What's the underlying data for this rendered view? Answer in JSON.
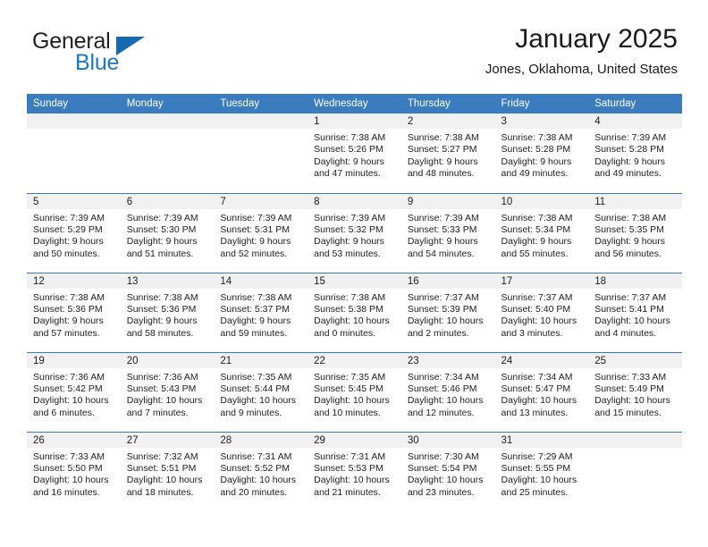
{
  "brand": {
    "name_part1": "General",
    "name_part2": "Blue",
    "accent_color": "#1b77c4"
  },
  "header": {
    "month_title": "January 2025",
    "location": "Jones, Oklahoma, United States"
  },
  "theme": {
    "header_bg": "#3a7cbe",
    "daynum_bg": "#f1f1f1",
    "text": "#222222"
  },
  "weekday_headers": [
    "Sunday",
    "Monday",
    "Tuesday",
    "Wednesday",
    "Thursday",
    "Friday",
    "Saturday"
  ],
  "weeks": [
    [
      {
        "day": "",
        "lines": []
      },
      {
        "day": "",
        "lines": []
      },
      {
        "day": "",
        "lines": []
      },
      {
        "day": "1",
        "lines": [
          "Sunrise: 7:38 AM",
          "Sunset: 5:26 PM",
          "Daylight: 9 hours",
          "and 47 minutes."
        ]
      },
      {
        "day": "2",
        "lines": [
          "Sunrise: 7:38 AM",
          "Sunset: 5:27 PM",
          "Daylight: 9 hours",
          "and 48 minutes."
        ]
      },
      {
        "day": "3",
        "lines": [
          "Sunrise: 7:38 AM",
          "Sunset: 5:28 PM",
          "Daylight: 9 hours",
          "and 49 minutes."
        ]
      },
      {
        "day": "4",
        "lines": [
          "Sunrise: 7:39 AM",
          "Sunset: 5:28 PM",
          "Daylight: 9 hours",
          "and 49 minutes."
        ]
      }
    ],
    [
      {
        "day": "5",
        "lines": [
          "Sunrise: 7:39 AM",
          "Sunset: 5:29 PM",
          "Daylight: 9 hours",
          "and 50 minutes."
        ]
      },
      {
        "day": "6",
        "lines": [
          "Sunrise: 7:39 AM",
          "Sunset: 5:30 PM",
          "Daylight: 9 hours",
          "and 51 minutes."
        ]
      },
      {
        "day": "7",
        "lines": [
          "Sunrise: 7:39 AM",
          "Sunset: 5:31 PM",
          "Daylight: 9 hours",
          "and 52 minutes."
        ]
      },
      {
        "day": "8",
        "lines": [
          "Sunrise: 7:39 AM",
          "Sunset: 5:32 PM",
          "Daylight: 9 hours",
          "and 53 minutes."
        ]
      },
      {
        "day": "9",
        "lines": [
          "Sunrise: 7:39 AM",
          "Sunset: 5:33 PM",
          "Daylight: 9 hours",
          "and 54 minutes."
        ]
      },
      {
        "day": "10",
        "lines": [
          "Sunrise: 7:38 AM",
          "Sunset: 5:34 PM",
          "Daylight: 9 hours",
          "and 55 minutes."
        ]
      },
      {
        "day": "11",
        "lines": [
          "Sunrise: 7:38 AM",
          "Sunset: 5:35 PM",
          "Daylight: 9 hours",
          "and 56 minutes."
        ]
      }
    ],
    [
      {
        "day": "12",
        "lines": [
          "Sunrise: 7:38 AM",
          "Sunset: 5:36 PM",
          "Daylight: 9 hours",
          "and 57 minutes."
        ]
      },
      {
        "day": "13",
        "lines": [
          "Sunrise: 7:38 AM",
          "Sunset: 5:36 PM",
          "Daylight: 9 hours",
          "and 58 minutes."
        ]
      },
      {
        "day": "14",
        "lines": [
          "Sunrise: 7:38 AM",
          "Sunset: 5:37 PM",
          "Daylight: 9 hours",
          "and 59 minutes."
        ]
      },
      {
        "day": "15",
        "lines": [
          "Sunrise: 7:38 AM",
          "Sunset: 5:38 PM",
          "Daylight: 10 hours",
          "and 0 minutes."
        ]
      },
      {
        "day": "16",
        "lines": [
          "Sunrise: 7:37 AM",
          "Sunset: 5:39 PM",
          "Daylight: 10 hours",
          "and 2 minutes."
        ]
      },
      {
        "day": "17",
        "lines": [
          "Sunrise: 7:37 AM",
          "Sunset: 5:40 PM",
          "Daylight: 10 hours",
          "and 3 minutes."
        ]
      },
      {
        "day": "18",
        "lines": [
          "Sunrise: 7:37 AM",
          "Sunset: 5:41 PM",
          "Daylight: 10 hours",
          "and 4 minutes."
        ]
      }
    ],
    [
      {
        "day": "19",
        "lines": [
          "Sunrise: 7:36 AM",
          "Sunset: 5:42 PM",
          "Daylight: 10 hours",
          "and 6 minutes."
        ]
      },
      {
        "day": "20",
        "lines": [
          "Sunrise: 7:36 AM",
          "Sunset: 5:43 PM",
          "Daylight: 10 hours",
          "and 7 minutes."
        ]
      },
      {
        "day": "21",
        "lines": [
          "Sunrise: 7:35 AM",
          "Sunset: 5:44 PM",
          "Daylight: 10 hours",
          "and 9 minutes."
        ]
      },
      {
        "day": "22",
        "lines": [
          "Sunrise: 7:35 AM",
          "Sunset: 5:45 PM",
          "Daylight: 10 hours",
          "and 10 minutes."
        ]
      },
      {
        "day": "23",
        "lines": [
          "Sunrise: 7:34 AM",
          "Sunset: 5:46 PM",
          "Daylight: 10 hours",
          "and 12 minutes."
        ]
      },
      {
        "day": "24",
        "lines": [
          "Sunrise: 7:34 AM",
          "Sunset: 5:47 PM",
          "Daylight: 10 hours",
          "and 13 minutes."
        ]
      },
      {
        "day": "25",
        "lines": [
          "Sunrise: 7:33 AM",
          "Sunset: 5:49 PM",
          "Daylight: 10 hours",
          "and 15 minutes."
        ]
      }
    ],
    [
      {
        "day": "26",
        "lines": [
          "Sunrise: 7:33 AM",
          "Sunset: 5:50 PM",
          "Daylight: 10 hours",
          "and 16 minutes."
        ]
      },
      {
        "day": "27",
        "lines": [
          "Sunrise: 7:32 AM",
          "Sunset: 5:51 PM",
          "Daylight: 10 hours",
          "and 18 minutes."
        ]
      },
      {
        "day": "28",
        "lines": [
          "Sunrise: 7:31 AM",
          "Sunset: 5:52 PM",
          "Daylight: 10 hours",
          "and 20 minutes."
        ]
      },
      {
        "day": "29",
        "lines": [
          "Sunrise: 7:31 AM",
          "Sunset: 5:53 PM",
          "Daylight: 10 hours",
          "and 21 minutes."
        ]
      },
      {
        "day": "30",
        "lines": [
          "Sunrise: 7:30 AM",
          "Sunset: 5:54 PM",
          "Daylight: 10 hours",
          "and 23 minutes."
        ]
      },
      {
        "day": "31",
        "lines": [
          "Sunrise: 7:29 AM",
          "Sunset: 5:55 PM",
          "Daylight: 10 hours",
          "and 25 minutes."
        ]
      },
      {
        "day": "",
        "lines": []
      }
    ]
  ]
}
